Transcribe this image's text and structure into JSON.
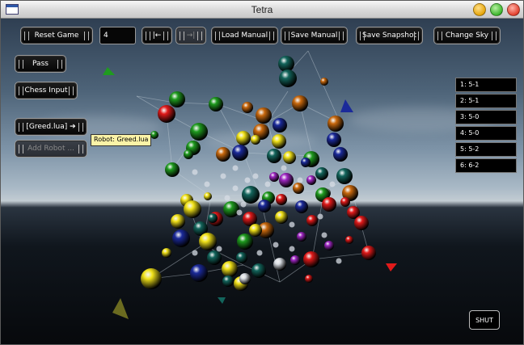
{
  "window": {
    "title": "Tetra"
  },
  "toolbar": {
    "reset_label": "Reset Game",
    "move_value": "4",
    "first_label": "|←",
    "last_label": "→|",
    "load_label": "Load Manual",
    "save_label": "Save Manual",
    "snapshot_label": "Save Snapshot",
    "sky_label": "Change Sky"
  },
  "left_panel": {
    "pass_label": "Pass",
    "chess_label": "Chess Input",
    "robot_label": "[Greed.lua] ➔",
    "add_robot_label": "Add Robot ..."
  },
  "tooltip": "Robot: Greed.lua",
  "scoreboard": [
    "1: 5-1",
    "2: 5-1",
    "3: 5-0",
    "4: 5-0",
    "5: 5-2",
    "6: 6-2"
  ],
  "shut_label": "SHUT",
  "colors": {
    "green": "#1f9b1f",
    "red": "#e11a1a",
    "yellow": "#f2e31a",
    "blue": "#1b2a9a",
    "orange": "#c9690e",
    "teal": "#13655c",
    "purple": "#9f27c3",
    "white": "#d9dde3"
  }
}
